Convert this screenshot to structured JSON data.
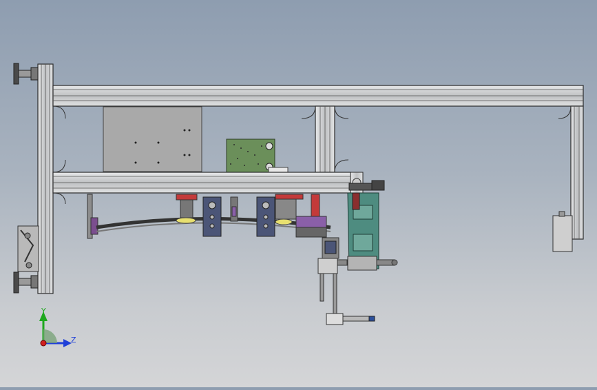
{
  "app": {
    "title": ""
  },
  "viewport": {
    "view": "front",
    "background_top": "#8e9db0",
    "background_bottom": "#d4d5d7"
  },
  "triad": {
    "y_label": "Y",
    "z_label": "Z",
    "y_color": "#1fa81f",
    "z_color": "#1f3fd8",
    "x_color": "#d01f1f"
  },
  "colors": {
    "frame": "#c9cbcd",
    "frame_edge": "#2b2b2b",
    "plate_gray": "#a6a6a6",
    "pcb_green": "#6b8f5a",
    "bracket_teal": "#4e8c80",
    "bracket_navy": "#4b5577",
    "cylinder_red": "#c33a3a",
    "purple": "#8a5fa8",
    "yellow": "#e8e070"
  }
}
